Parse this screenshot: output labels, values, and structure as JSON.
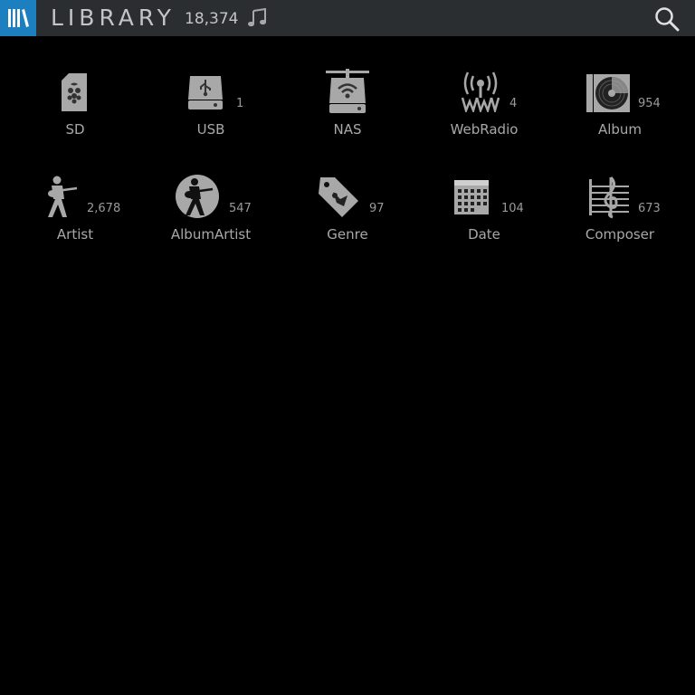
{
  "header": {
    "title": "LIBRARY",
    "total_tracks": "18,374",
    "menu_icon": "library-icon",
    "note_icon": "music-note-icon",
    "search_icon": "search-icon",
    "accent_color": "#1b7fc0"
  },
  "tiles": [
    {
      "label": "SD",
      "count": "",
      "icon": "sd-card-icon"
    },
    {
      "label": "USB",
      "count": "1",
      "icon": "usb-drive-icon"
    },
    {
      "label": "NAS",
      "count": "",
      "icon": "nas-drive-icon"
    },
    {
      "label": "WebRadio",
      "count": "4",
      "icon": "radio-antenna-icon"
    },
    {
      "label": "Album",
      "count": "954",
      "icon": "vinyl-album-icon"
    },
    {
      "label": "Artist",
      "count": "2,678",
      "icon": "guitarist-icon"
    },
    {
      "label": "AlbumArtist",
      "count": "547",
      "icon": "guitarist-circle-icon"
    },
    {
      "label": "Genre",
      "count": "97",
      "icon": "genre-tag-icon"
    },
    {
      "label": "Date",
      "count": "104",
      "icon": "calendar-icon"
    },
    {
      "label": "Composer",
      "count": "673",
      "icon": "treble-clef-icon"
    }
  ]
}
